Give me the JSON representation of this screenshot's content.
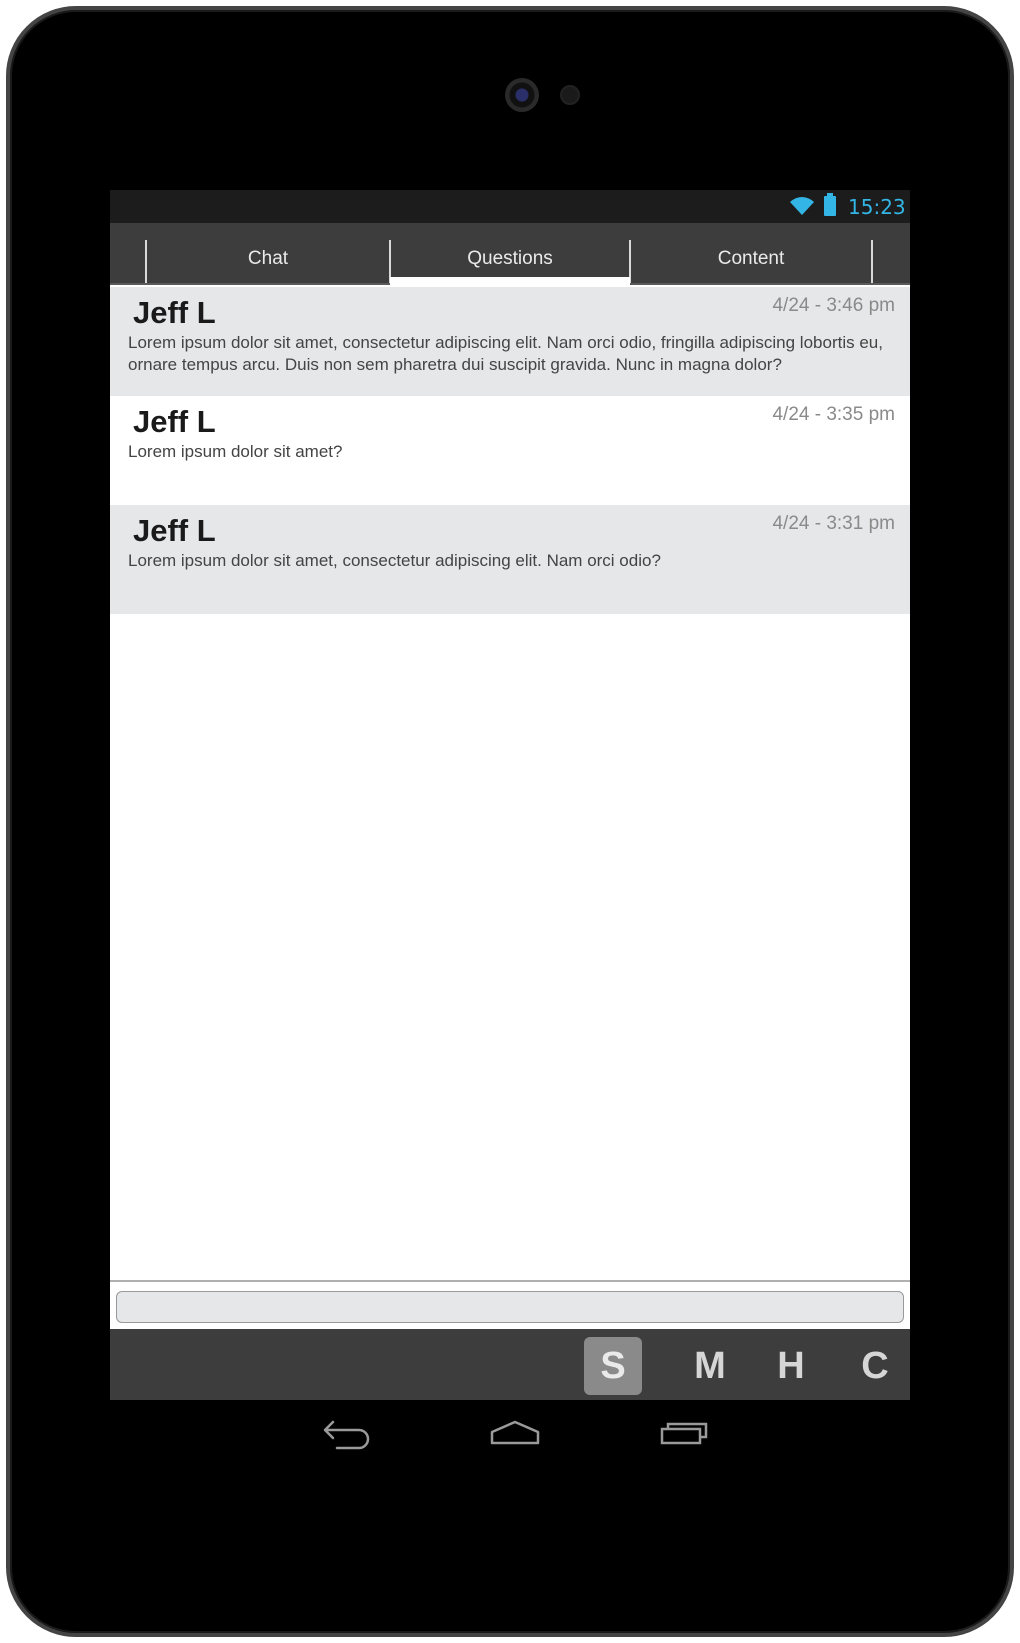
{
  "status_bar": {
    "time": "15:23",
    "wifi_icon": "wifi-icon",
    "battery_icon": "battery-icon",
    "accent_color": "#33b5e5"
  },
  "tabs": [
    {
      "label": "Chat",
      "selected": false
    },
    {
      "label": "Questions",
      "selected": true
    },
    {
      "label": "Content",
      "selected": false
    }
  ],
  "messages": [
    {
      "author": "Jeff L",
      "time": "4/24 - 3:46 pm",
      "body": "Lorem ipsum dolor sit amet, consectetur adipiscing elit. Nam orci odio, fringilla adipiscing lobortis eu, ornare tempus arcu. Duis non sem pharetra dui suscipit gravida. Nunc in magna dolor?"
    },
    {
      "author": "Jeff L",
      "time": "4/24 - 3:35 pm",
      "body": "Lorem ipsum dolor sit amet?"
    },
    {
      "author": "Jeff L",
      "time": "4/24 - 3:31 pm",
      "body": "Lorem ipsum dolor sit amet, consectetur adipiscing elit. Nam orci odio?"
    }
  ],
  "input": {
    "value": "",
    "placeholder": ""
  },
  "toolbar": {
    "buttons": [
      {
        "label": "S",
        "active": true
      },
      {
        "label": "M",
        "active": false
      },
      {
        "label": "H",
        "active": false
      },
      {
        "label": "C",
        "active": false
      }
    ]
  },
  "nav_icons": [
    "back-icon",
    "home-icon",
    "recent-apps-icon"
  ]
}
